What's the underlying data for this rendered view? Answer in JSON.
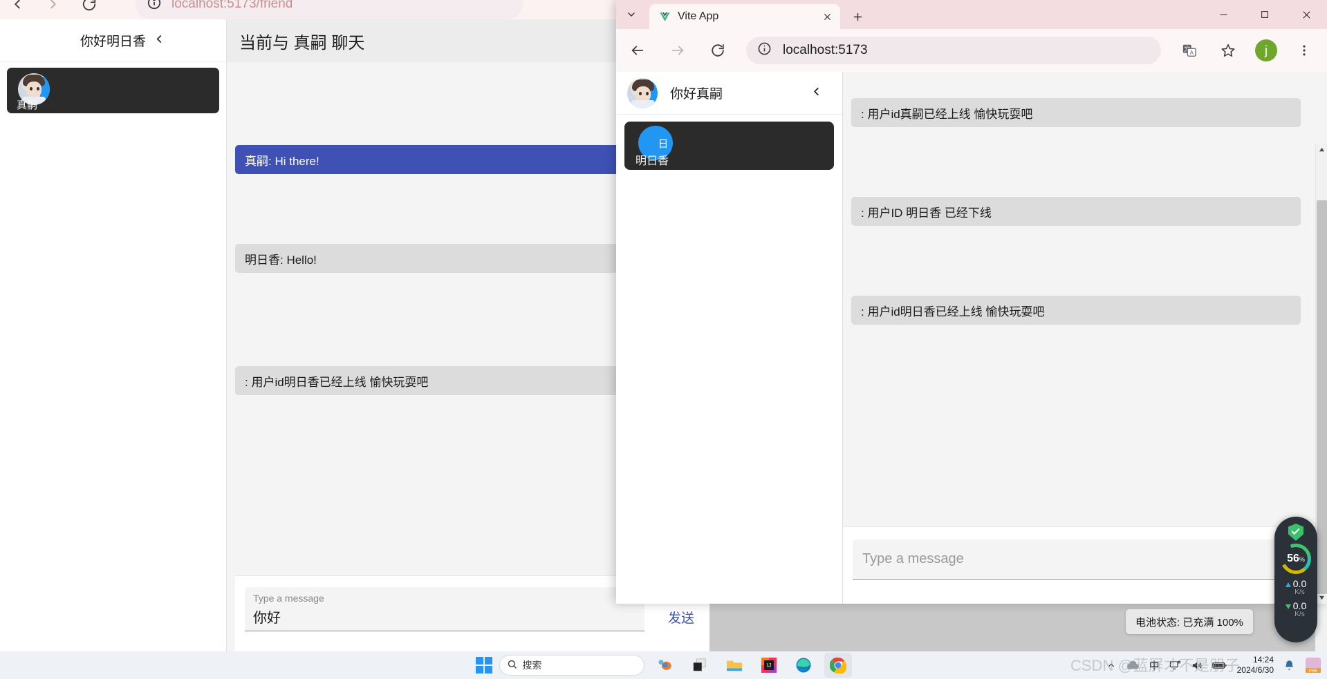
{
  "rear_browser": {
    "url": "localhost:5173/friend",
    "nav": {
      "back": "back-arrow",
      "forward": "forward-arrow",
      "reload": "reload"
    },
    "app": {
      "sidebar": {
        "greeting": "你好明日香",
        "collapse_icon": "chevron-left-icon",
        "friends": [
          {
            "name": "真嗣",
            "avatar": "photo-avatar"
          }
        ]
      },
      "chat": {
        "header": "当前与 真嗣 聊天",
        "messages": [
          {
            "text": "真嗣: Hi there!",
            "side": "self"
          },
          {
            "text": "明日香: Hello!",
            "side": "other"
          },
          {
            "text": ": 用户id明日香已经上线 愉快玩耍吧",
            "side": "other"
          }
        ],
        "input_label": "Type a message",
        "input_value": "你好",
        "send_label": "发送"
      }
    }
  },
  "fg_browser": {
    "tab": {
      "title": "Vite App",
      "favicon": "vue-logo-icon",
      "close_icon": "close-icon"
    },
    "new_tab_label": "+",
    "tab_search_icon": "chevron-down-icon",
    "window_controls": {
      "minimize": "minimize-icon",
      "maximize": "maximize-icon",
      "close": "close-icon"
    },
    "toolbar": {
      "back": "back-arrow-icon",
      "forward": "forward-arrow-icon",
      "reload": "reload-icon",
      "site_info": "info-circle-icon",
      "url": "localhost:5173",
      "translate": "translate-icon",
      "bookmark": "star-icon",
      "profile_initial": "j",
      "menu": "kebab-menu-icon"
    },
    "app": {
      "sidebar": {
        "greeting": "你好真嗣",
        "collapse_icon": "chevron-left-icon",
        "friends": [
          {
            "name": "明日香",
            "avatar_letter": "日"
          }
        ]
      },
      "chat": {
        "messages": [
          {
            "text": ": 用户id真嗣已经上线 愉快玩耍吧"
          },
          {
            "text": ": 用户ID 明日香 已经下线"
          },
          {
            "text": ": 用户id明日香已经上线 愉快玩耍吧"
          }
        ],
        "input_placeholder": "Type a message"
      }
    }
  },
  "perf_widget": {
    "shield_icon": "shield-check-icon",
    "cpu_percent": "56",
    "percent_sign": "%",
    "upload_value": "0.0",
    "upload_unit": "K/s",
    "download_value": "0.0",
    "download_unit": "K/s"
  },
  "battery_tooltip": "电池状态: 已充满 100%",
  "taskbar": {
    "start_icon": "windows-logo-icon",
    "search_icon": "search-icon",
    "search_placeholder": "搜索",
    "apps": [
      {
        "name": "weather-widget-icon"
      },
      {
        "name": "file-stack-icon"
      },
      {
        "name": "file-explorer-icon"
      },
      {
        "name": "intellij-idea-icon"
      },
      {
        "name": "microsoft-edge-icon"
      },
      {
        "name": "google-chrome-icon"
      }
    ],
    "tray": {
      "overflow_icon": "chevron-up-icon",
      "cloud_icon": "cloud-icon",
      "ime_label": "中",
      "display_icon": "monitor-icon",
      "volume_icon": "speaker-icon",
      "battery_icon": "battery-icon",
      "time": "14:24",
      "date": "2024/6/30",
      "notification_icon": "bell-icon",
      "pre_badge": "PRE"
    }
  },
  "watermark": "CSDN @蓝屏才不是朋子"
}
